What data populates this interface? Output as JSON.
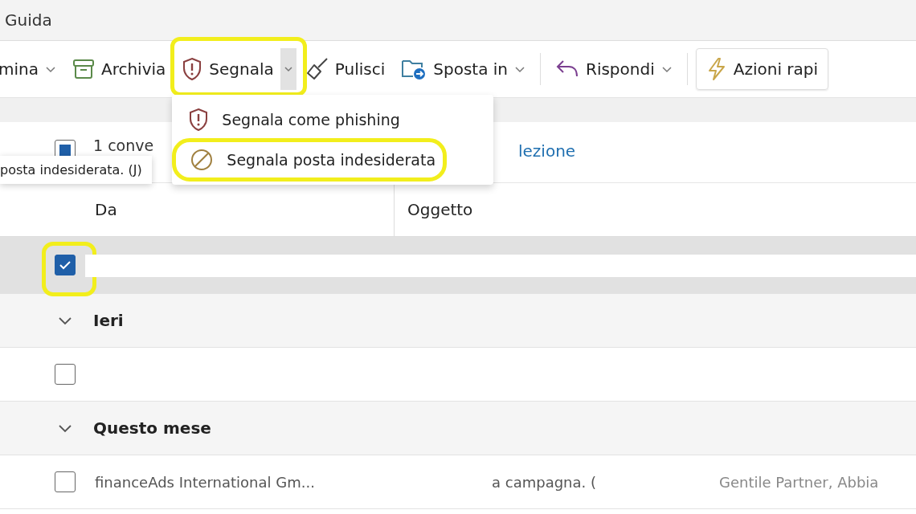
{
  "menu_bar": {
    "label": "Guida"
  },
  "toolbar": {
    "groups": [
      {
        "items": [
          {
            "kind": "dropdown",
            "label": "mina",
            "highlighted": false
          },
          {
            "kind": "plain",
            "label": "Archivia",
            "highlighted": false
          },
          {
            "kind": "split",
            "label": "Segnala",
            "highlighted": true,
            "expanded": true
          },
          {
            "kind": "plain",
            "label": "Pulisci",
            "highlighted": false
          },
          {
            "kind": "dropdown",
            "label": "Sposta in",
            "highlighted": false
          }
        ]
      },
      {
        "items": [
          {
            "kind": "dropdown",
            "label": "Rispondi",
            "highlighted": false
          }
        ]
      },
      {
        "items": [
          {
            "kind": "bordered",
            "label": "Azioni rapi",
            "highlighted": false
          }
        ]
      }
    ]
  },
  "report_menu": {
    "items": [
      {
        "label": "Segnala come phishing",
        "highlighted": false
      },
      {
        "label": "Segnala posta indesiderata",
        "highlighted": true
      }
    ]
  },
  "tooltip": "posta indesiderata. (J)",
  "selection_bar": {
    "indeterminate": true,
    "summary": "1 conve",
    "link": "lezione"
  },
  "columns": [
    "Da",
    "Oggetto"
  ],
  "rows": [
    {
      "kind": "message",
      "selected": true,
      "checked": true,
      "highlighted": true,
      "redacted": true
    },
    {
      "kind": "group",
      "label": "Ieri",
      "expanded": true
    },
    {
      "kind": "message",
      "selected": false,
      "checked": false,
      "highlighted": false,
      "redacted": false
    },
    {
      "kind": "group",
      "label": "Questo mese",
      "expanded": true
    },
    {
      "kind": "message",
      "selected": false,
      "checked": false,
      "highlighted": false,
      "redacted": false,
      "cells": [
        "financeAds International Gm...",
        "a campagna. (",
        "Gentile Partner, Abbia"
      ]
    }
  ]
}
